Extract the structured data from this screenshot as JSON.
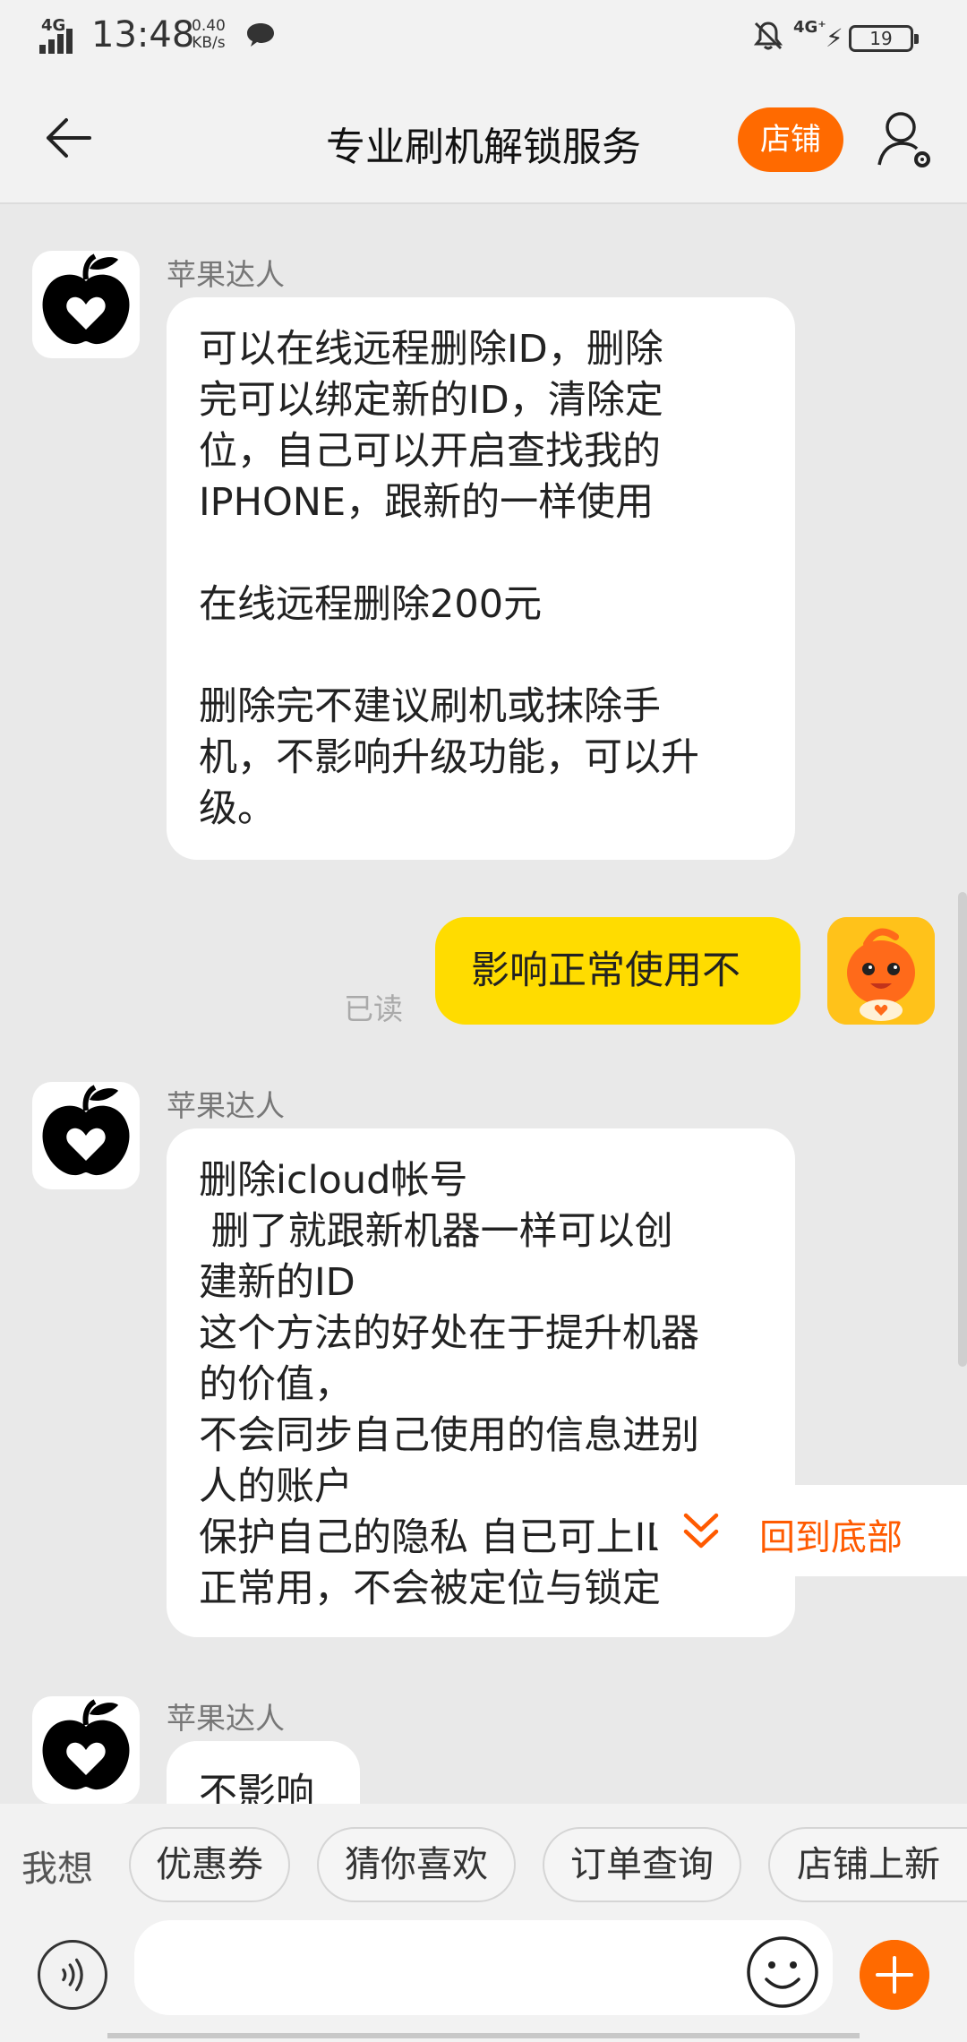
{
  "status_bar": {
    "network": "4G",
    "time": "13:48",
    "speed_value": "0.40",
    "speed_unit": "KB/s",
    "network_right": "4G⁺",
    "battery": "19"
  },
  "header": {
    "title": "专业刷机解锁服务",
    "shop_label": "店铺"
  },
  "messages": [
    {
      "sender": "苹果达人",
      "text": "可以在线远程删除ID，删除\n完可以绑定新的ID，清除定\n位，自己可以开启查找我的\nIPHONE，跟新的一样使用\n\n在线远程删除200元\n\n删除完不建议刷机或抹除手\n机，不影响升级功能，可以升\n级。"
    },
    {
      "text": "影响正常使用不",
      "status": "已读"
    },
    {
      "sender": "苹果达人",
      "text": "删除icloud帐号\n 删了就跟新机器一样可以创\n建新的ID\n这个方法的好处在于提升机器\n的价值，\n不会同步自己使用的信息进别\n人的账户\n保护自己的隐私 自已可上ID\n正常用，不会被定位与锁定"
    },
    {
      "sender": "苹果达人",
      "text": "不影响"
    }
  ],
  "back_to_bottom": "回到底部",
  "quick_bar": {
    "label": "我想",
    "chips": [
      "优惠券",
      "猜你喜欢",
      "订单查询",
      "店铺上新"
    ]
  },
  "input": {
    "placeholder": ""
  },
  "colors": {
    "accent": "#ff6a00",
    "my_bubble": "#ffdc00"
  }
}
